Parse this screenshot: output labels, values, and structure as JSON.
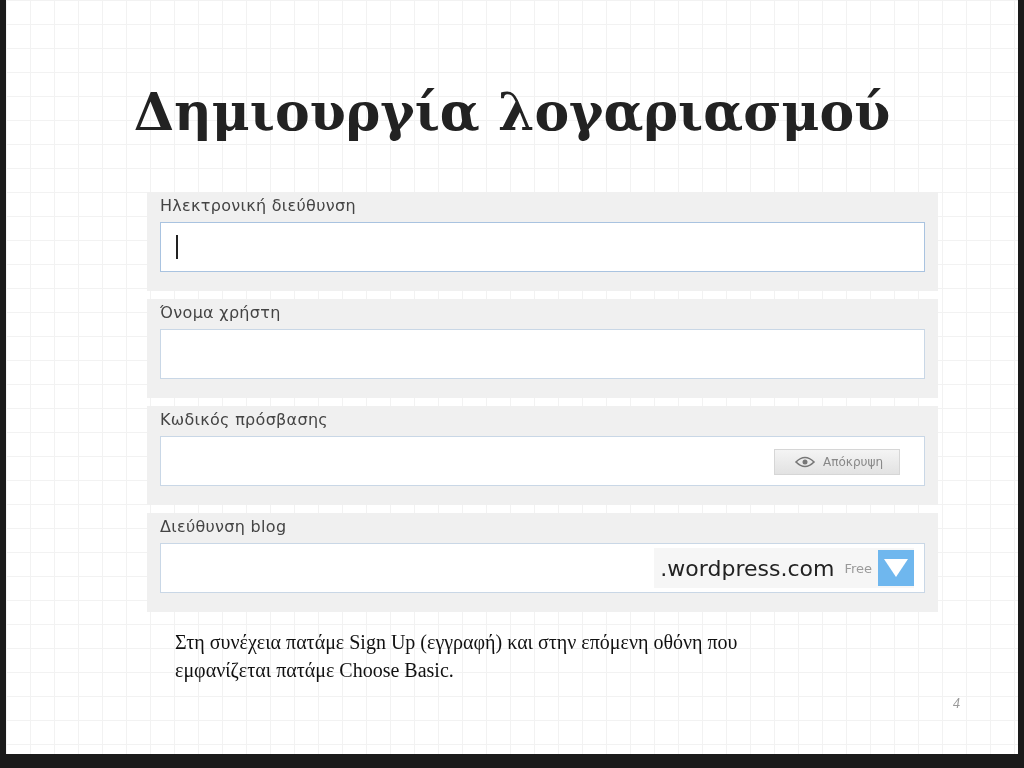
{
  "title": "Δημιουργία λογαριασμού",
  "form": {
    "fields": [
      {
        "kind": "text",
        "label": "Ηλεκτρονική διεύθυνση",
        "focused": true
      },
      {
        "kind": "text",
        "label": "Όνομα χρήστη",
        "focused": false
      },
      {
        "kind": "password",
        "label": "Κωδικός πρόσβασης",
        "focused": false,
        "button": "Απόκρυψη"
      },
      {
        "kind": "blog",
        "label": "Διεύθυνση blog",
        "focused": false,
        "suffix": ".wordpress.com",
        "badge": "Free"
      }
    ]
  },
  "caption": "Στη συνέχεια πατάμε Sign Up (εγγραφή) και στην επόμενη οθόνη που εμφανίζεται πατάμε Choose Basic.",
  "slide_number": "4"
}
